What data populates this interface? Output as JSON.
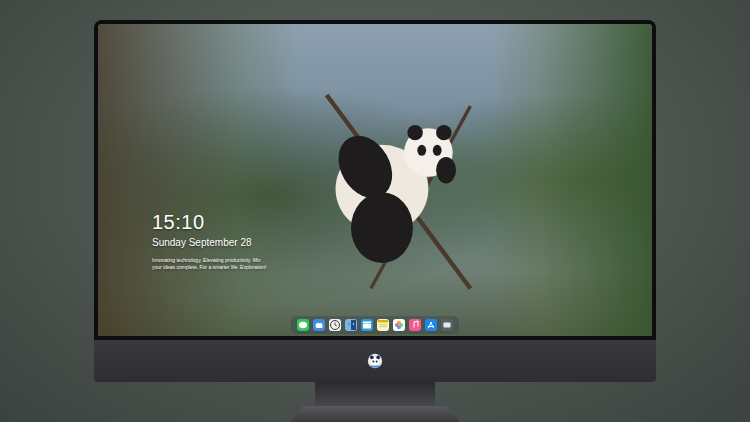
{
  "lock_screen": {
    "time": "15:10",
    "date": "Sunday September 28",
    "tagline": "Innovating technology, Elevating productivity. Mix your ideas complete. For a smarter life. Exploration!"
  }
}
